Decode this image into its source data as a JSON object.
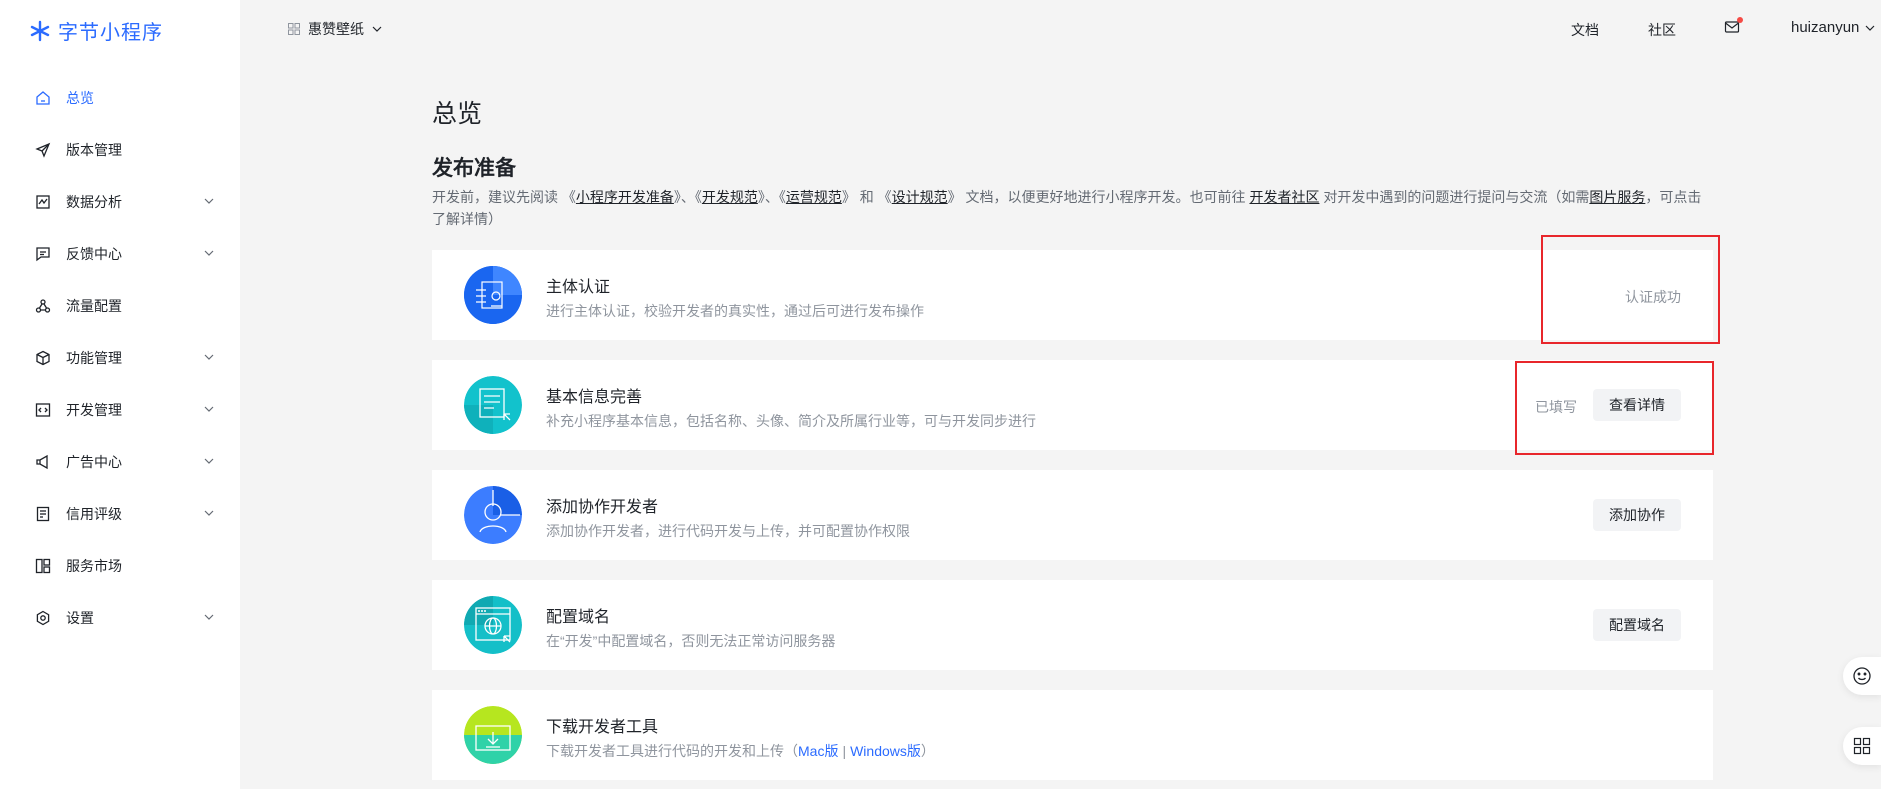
{
  "brand": {
    "name": "字节小程序",
    "color": "#2b6bff"
  },
  "sidebar": {
    "items": [
      {
        "label": "总览",
        "icon": "home-icon",
        "active": true,
        "expandable": false
      },
      {
        "label": "版本管理",
        "icon": "send-icon",
        "active": false,
        "expandable": false
      },
      {
        "label": "数据分析",
        "icon": "chart-icon",
        "active": false,
        "expandable": true
      },
      {
        "label": "反馈中心",
        "icon": "message-icon",
        "active": false,
        "expandable": true
      },
      {
        "label": "流量配置",
        "icon": "share-icon",
        "active": false,
        "expandable": false
      },
      {
        "label": "功能管理",
        "icon": "cube-icon",
        "active": false,
        "expandable": true
      },
      {
        "label": "开发管理",
        "icon": "code-icon",
        "active": false,
        "expandable": true
      },
      {
        "label": "广告中心",
        "icon": "megaphone-icon",
        "active": false,
        "expandable": true
      },
      {
        "label": "信用评级",
        "icon": "document-icon",
        "active": false,
        "expandable": true
      },
      {
        "label": "服务市场",
        "icon": "grid-icon",
        "active": false,
        "expandable": false
      },
      {
        "label": "设置",
        "icon": "settings-icon",
        "active": false,
        "expandable": true
      }
    ]
  },
  "topbar": {
    "app_name": "惠赞壁纸",
    "docs": "文档",
    "community": "社区",
    "username": "huizanyun"
  },
  "main": {
    "page_title": "总览",
    "section_title": "发布准备",
    "desc": {
      "p1": "开发前，建议先阅读 《",
      "l1": "小程序开发准备",
      "p2": "》、《",
      "l2": "开发规范",
      "p3": "》、《",
      "l3": "运营规范",
      "p4": "》 和 《",
      "l4": "设计规范",
      "p5": "》 文档，以便更好地进行小程序开发。也可前往 ",
      "l5": "开发者社区",
      "p6": " 对开发中遇到的问题进行提问与交流（如需",
      "l6": "图片服务",
      "p7": "，可点击了解详情）"
    },
    "cards": [
      {
        "title": "主体认证",
        "desc": "进行主体认证，校验开发者的真实性，通过后可进行发布操作",
        "status": "认证成功",
        "button": null,
        "icon_color": "#1a66f0"
      },
      {
        "title": "基本信息完善",
        "desc": "补充小程序基本信息，包括名称、头像、简介及所属行业等，可与开发同步进行",
        "status": "已填写",
        "button": "查看详情",
        "icon_color": "#12c2cc"
      },
      {
        "title": "添加协作开发者",
        "desc": "添加协作开发者，进行代码开发与上传，并可配置协作权限",
        "status": null,
        "button": "添加协作",
        "icon_color": "#2b6bff"
      },
      {
        "title": "配置域名",
        "desc": "在“开发”中配置域名，否则无法正常访问服务器",
        "status": null,
        "button": "配置域名",
        "icon_color": "#14bfc8"
      },
      {
        "title": "下载开发者工具",
        "desc_prefix": "下载开发者工具进行代码的开发和上传（",
        "link_mac": "Mac版",
        "link_sep": "|",
        "link_win": "Windows版",
        "desc_suffix": "）",
        "icon_color": "#b6e61f"
      }
    ]
  },
  "colors": {
    "accent": "#2b6bff",
    "highlight": "#e8262b",
    "notify_dot": "#f54a45"
  }
}
